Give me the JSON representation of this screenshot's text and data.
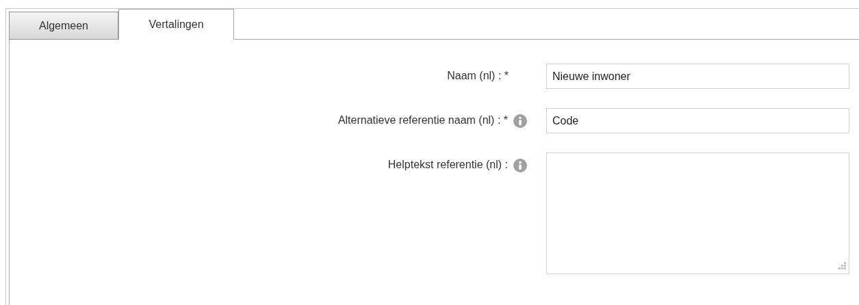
{
  "tabs": [
    {
      "label": "Algemeen",
      "selected": false
    },
    {
      "label": "Vertalingen",
      "selected": true
    }
  ],
  "fields": [
    {
      "kind": "text",
      "label": "Naam (nl) : *",
      "info": false,
      "value": "Nieuwe inwoner"
    },
    {
      "kind": "text",
      "label": "Alternatieve referentie naam (nl) : *",
      "info": true,
      "value": "Code"
    },
    {
      "kind": "textarea",
      "label": "Helptekst referentie (nl) :",
      "info": true
    }
  ]
}
